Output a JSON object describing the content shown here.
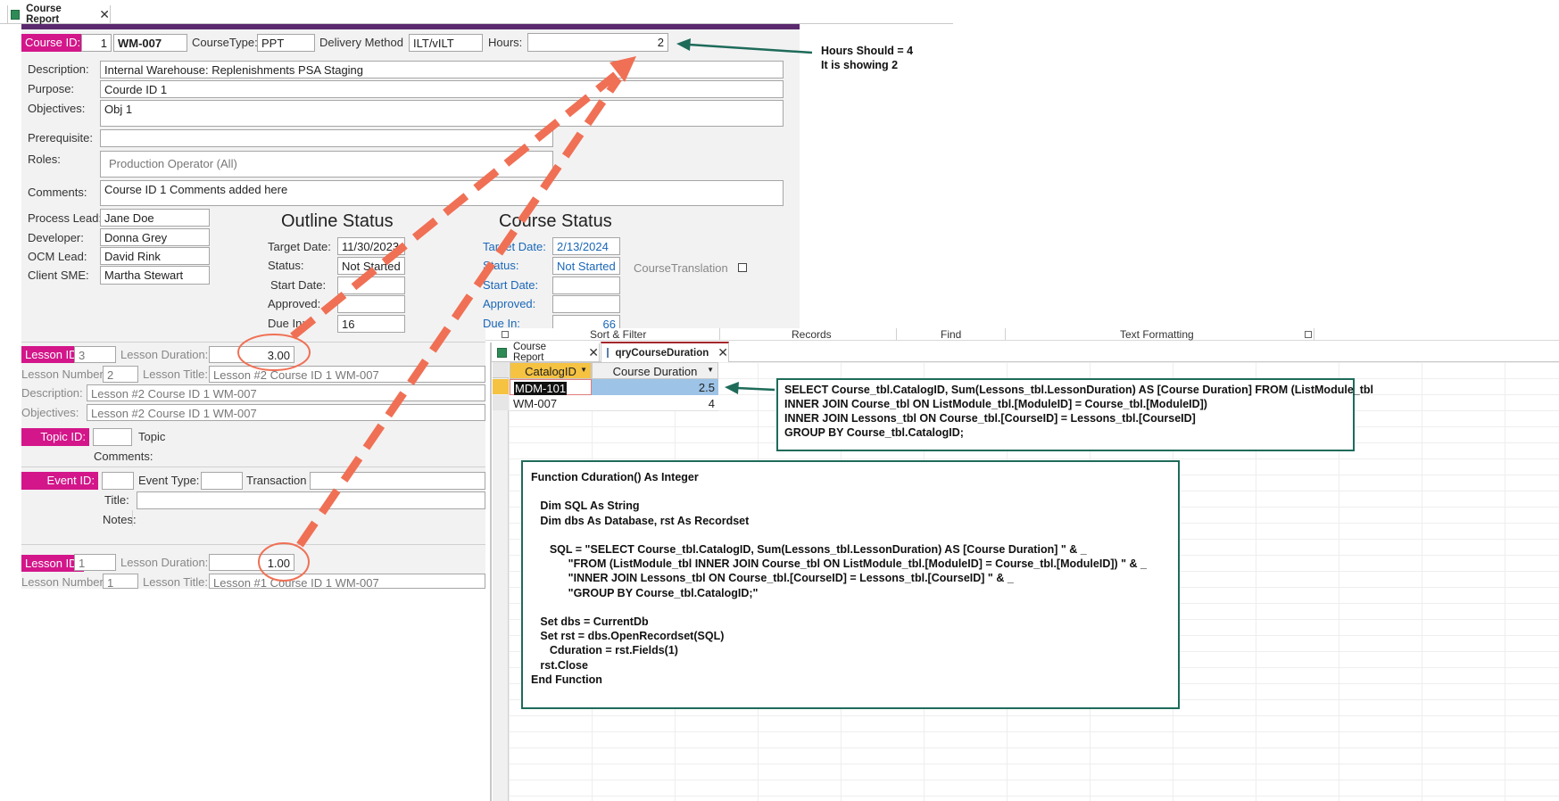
{
  "report_tab": {
    "title": "Course Report",
    "close": "✕"
  },
  "header": {
    "course_id_label": "Course ID:",
    "course_id_num": "1",
    "course_code": "WM-007",
    "course_type_label": "CourseType:",
    "course_type": "PPT",
    "delivery_label": "Delivery Method",
    "delivery": "ILT/vILT",
    "hours_label": "Hours:",
    "hours": "2"
  },
  "details": {
    "description_label": "Description:",
    "description": "Internal Warehouse: Replenishments PSA Staging",
    "purpose_label": "Purpose:",
    "purpose": "Courde ID 1",
    "objectives_label": "Objectives:",
    "objectives": "Obj 1",
    "prerequisite_label": "Prerequisite:",
    "prerequisite": "",
    "roles_label": "Roles:",
    "roles": "Production Operator (All)",
    "comments_label": "Comments:",
    "comments": "Course ID 1 Comments added here"
  },
  "people": {
    "process_lead_label": "Process Lead:",
    "process_lead": "Jane Doe",
    "developer_label": "Developer:",
    "developer": "Donna Grey",
    "ocm_lead_label": "OCM Lead:",
    "ocm_lead": "David Rink",
    "client_sme_label": "Client SME:",
    "client_sme": "Martha Stewart"
  },
  "outline_status": {
    "title": "Outline Status",
    "target_label": "Target Date:",
    "target": "11/30/2023",
    "status_label": "Status:",
    "status": "Not Started",
    "start_label": "Start Date:",
    "start": "",
    "approved_label": "Approved:",
    "approved": "",
    "due_label": "Due In:",
    "due": "16"
  },
  "course_status": {
    "title": "Course Status",
    "target_label": "Target Date:",
    "target": "2/13/2024",
    "status_label": "Status:",
    "status": "Not Started",
    "start_label": "Start Date:",
    "start": "",
    "approved_label": "Approved:",
    "approved": "",
    "due_label": "Due In:",
    "due": "66",
    "translation_label": "CourseTranslation"
  },
  "lesson1": {
    "id_label": "Lesson ID:",
    "id": "3",
    "duration_label": "Lesson Duration:",
    "duration": "3.00",
    "number_label": "Lesson Number:",
    "number": "2",
    "title_label": "Lesson Title:",
    "title": "Lesson #2 Course ID 1 WM-007",
    "description_label": "Description:",
    "description": "Lesson #2 Course ID 1 WM-007",
    "objectives_label": "Objectives:",
    "objectives": "Lesson #2 Course ID 1 WM-007"
  },
  "topic": {
    "id_label": "Topic ID:",
    "topic_label": "Topic",
    "comments_label": "Comments:"
  },
  "event": {
    "id_label": "Event ID:",
    "type_label": "Event Type:",
    "transaction_label": "Transaction",
    "title_label": "Title:",
    "notes_label": "Notes:"
  },
  "lesson2": {
    "id_label": "Lesson ID:",
    "id": "1",
    "duration_label": "Lesson Duration:",
    "duration": "1.00",
    "number_label": "Lesson Number:",
    "number": "1",
    "title_label": "Lesson Title:",
    "title": "Lesson #1 Course ID 1 WM-007"
  },
  "ribbon": {
    "groups": [
      "Sort & Filter",
      "Records",
      "Find",
      "Text Formatting"
    ]
  },
  "query_window": {
    "tabs": [
      {
        "label": "Course Report",
        "close": "✕"
      },
      {
        "label": "qryCourseDuration",
        "close": "✕"
      }
    ],
    "columns": [
      "CatalogID",
      "Course Duration"
    ],
    "rows": [
      {
        "catalog_id": "MDM-101",
        "duration": "2.5"
      },
      {
        "catalog_id": "WM-007",
        "duration": "4"
      }
    ]
  },
  "annotations": {
    "hours_note_line1": "Hours Should = 4",
    "hours_note_line2": "It is showing 2",
    "sql_lines": [
      "SELECT Course_tbl.CatalogID, Sum(Lessons_tbl.LessonDuration) AS [Course Duration] FROM (ListModule_tbl",
      "INNER JOIN Course_tbl ON ListModule_tbl.[ModuleID] = Course_tbl.[ModuleID])",
      "INNER JOIN Lessons_tbl ON Course_tbl.[CourseID] = Lessons_tbl.[CourseID]",
      "GROUP BY Course_tbl.CatalogID;"
    ],
    "vba_code": "Function Cduration() As Integer\n\n   Dim SQL As String\n   Dim dbs As Database, rst As Recordset\n\n      SQL = \"SELECT Course_tbl.CatalogID, Sum(Lessons_tbl.LessonDuration) AS [Course Duration] \" & _\n            \"FROM (ListModule_tbl INNER JOIN Course_tbl ON ListModule_tbl.[ModuleID] = Course_tbl.[ModuleID]) \" & _\n            \"INNER JOIN Lessons_tbl ON Course_tbl.[CourseID] = Lessons_tbl.[CourseID] \" & _\n            \"GROUP BY Course_tbl.CatalogID;\"\n\n   Set dbs = CurrentDb\n   Set rst = dbs.OpenRecordset(SQL)\n      Cduration = rst.Fields(1)\n   rst.Close\nEnd Function"
  },
  "colors": {
    "magenta": "#d3168a",
    "purple_bar": "#5b2a6e",
    "arrow_orange": "#f07055",
    "arrow_green": "#1e6b5a",
    "selected_cell": "#9dc3e6"
  }
}
